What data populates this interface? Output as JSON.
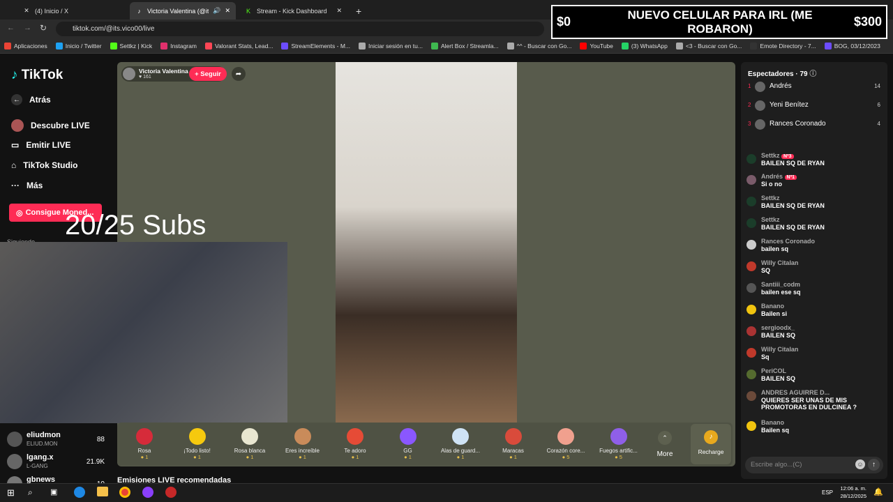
{
  "tabs": [
    {
      "title": "(4) Inicio / X",
      "icon": "x-icon"
    },
    {
      "title": "Victoria Valentina (@its.vico",
      "icon": "tiktok-icon"
    },
    {
      "title": "Stream - Kick Dashboard",
      "icon": "kick-icon"
    }
  ],
  "url": "tiktok.com/@its.vico00/live",
  "bookmarks": [
    "Aplicaciones",
    "Inicio / Twitter",
    "Settkz | Kick",
    "Instagram",
    "Valorant Stats, Lead...",
    "StreamElements - M...",
    "Iniciar sesión en tu...",
    "Alert Box / Streamla...",
    "^^ - Buscar con Go...",
    "YouTube",
    "(3) WhatsApp",
    "<3 - Buscar con Go...",
    "Emote Directory - 7...",
    "BOG, 03/12/2023"
  ],
  "overlay": {
    "left": "$0",
    "title": "NUEVO CELULAR PARA IRL (ME ROBARON)",
    "right": "$300"
  },
  "sidebar": {
    "logo": "TikTok",
    "back": "Atrás",
    "items": [
      "Descubre LIVE",
      "Emitir LIVE",
      "TikTok Studio",
      "Más"
    ],
    "coins": "Consigue Moned...",
    "following": "Siguiendo",
    "accounts": [
      {
        "name": "eliudmon",
        "sub": "ELIUD.MON",
        "count": "88"
      },
      {
        "name": "lgang.x",
        "sub": "L-GANG",
        "count": "21.9K"
      },
      {
        "name": "gbnews",
        "sub": "",
        "count": "10"
      }
    ]
  },
  "streamer": {
    "name": "Victoria Valentina",
    "likes": "161",
    "follow": "+ Seguir"
  },
  "subs": "20/25 Subs",
  "gifts": [
    {
      "name": "Rosa",
      "price": "1"
    },
    {
      "name": "¡Todo listo!",
      "price": "1"
    },
    {
      "name": "Rosa blanca",
      "price": "1"
    },
    {
      "name": "Eres increíble",
      "price": "1"
    },
    {
      "name": "Te adoro",
      "price": "1"
    },
    {
      "name": "GG",
      "price": "1"
    },
    {
      "name": "Alas de guard...",
      "price": "1"
    },
    {
      "name": "Maracas",
      "price": "1"
    },
    {
      "name": "Corazón core...",
      "price": "5"
    },
    {
      "name": "Fuegos artific...",
      "price": "5"
    }
  ],
  "gift_more": "More",
  "recharge": "Recharge",
  "recommend": "Emisiones LIVE recomendadas",
  "viewers": {
    "label": "Espectadores",
    "count": "79",
    "top": [
      {
        "rank": "1",
        "name": "Andrés",
        "score": "14"
      },
      {
        "rank": "2",
        "name": "Yeni Benítez",
        "score": "6"
      },
      {
        "rank": "3",
        "name": "Rances Coronado",
        "score": "4"
      }
    ]
  },
  "chat": [
    {
      "user": "Settkz",
      "text": "BAILEN SQ DE RYAN",
      "badge": "Nº3"
    },
    {
      "user": "Andrés",
      "text": "Si o no",
      "badge": "Nº1"
    },
    {
      "user": "Settkz",
      "text": "BAILEN SQ DE RYAN",
      "badge": ""
    },
    {
      "user": "Settkz",
      "text": "BAILEN SQ DE RYAN",
      "badge": ""
    },
    {
      "user": "Rances Coronado",
      "text": "bailen sq",
      "badge": ""
    },
    {
      "user": "Willy Citalan",
      "text": "SQ",
      "badge": ""
    },
    {
      "user": "Santiii_codm",
      "text": "bailen ese sq",
      "badge": ""
    },
    {
      "user": "Banano",
      "text": "Bailen si",
      "badge": ""
    },
    {
      "user": "sergioodx_",
      "text": "BAILEN SQ",
      "badge": ""
    },
    {
      "user": "Willy Citalan",
      "text": "Sq",
      "badge": ""
    },
    {
      "user": "PeriCOL",
      "text": "BAILEN SQ",
      "badge": ""
    },
    {
      "user": "ANDRES AGUIRRE D...",
      "text": "QUIERES SER UNAS DE MIS PROMOTORAS EN DULCINEA ?",
      "badge": ""
    },
    {
      "user": "Banano",
      "text": "Bailen sq",
      "badge": ""
    }
  ],
  "chat_input": {
    "placeholder": "Escribe algo...(C)"
  },
  "taskbar": {
    "time": "12:06 a. m.",
    "date": "28/12/2025",
    "lang": "ESP"
  }
}
